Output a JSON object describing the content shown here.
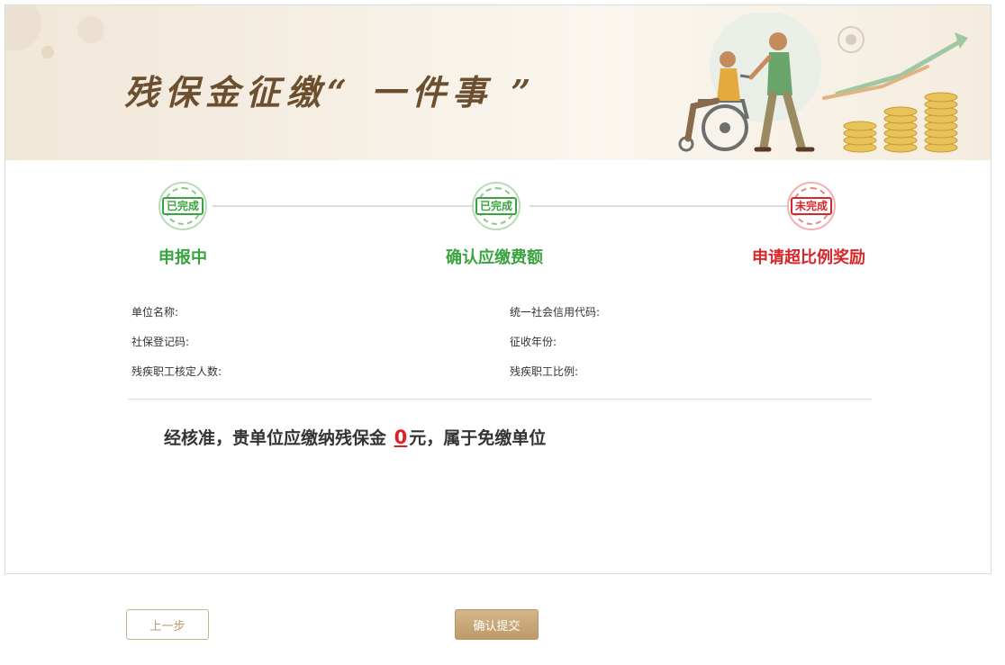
{
  "banner": {
    "title": "残保金征缴“ 一件事 ”"
  },
  "steps": [
    {
      "status": "已完成",
      "label": "申报中",
      "state": "done"
    },
    {
      "status": "已完成",
      "label": "确认应缴费额",
      "state": "done"
    },
    {
      "status": "未完成",
      "label": "申请超比例奖励",
      "state": "todo"
    }
  ],
  "info": {
    "unit_name_label": "单位名称:",
    "credit_code_label": "统一社会信用代码:",
    "social_security_label": "社保登记码:",
    "year_label": "征收年份:",
    "disabled_count_label": "残疾职工核定人数:",
    "disabled_ratio_label": "残疾职工比例:"
  },
  "result": {
    "prefix": "经核准，贵单位应缴纳残保金",
    "amount": "0",
    "suffix": "元，属于免缴单位"
  },
  "buttons": {
    "prev_label": "上一步",
    "submit_label": "确认提交"
  },
  "colors": {
    "done": "#39a33e",
    "todo": "#d8262a",
    "accent": "#c4a272"
  }
}
